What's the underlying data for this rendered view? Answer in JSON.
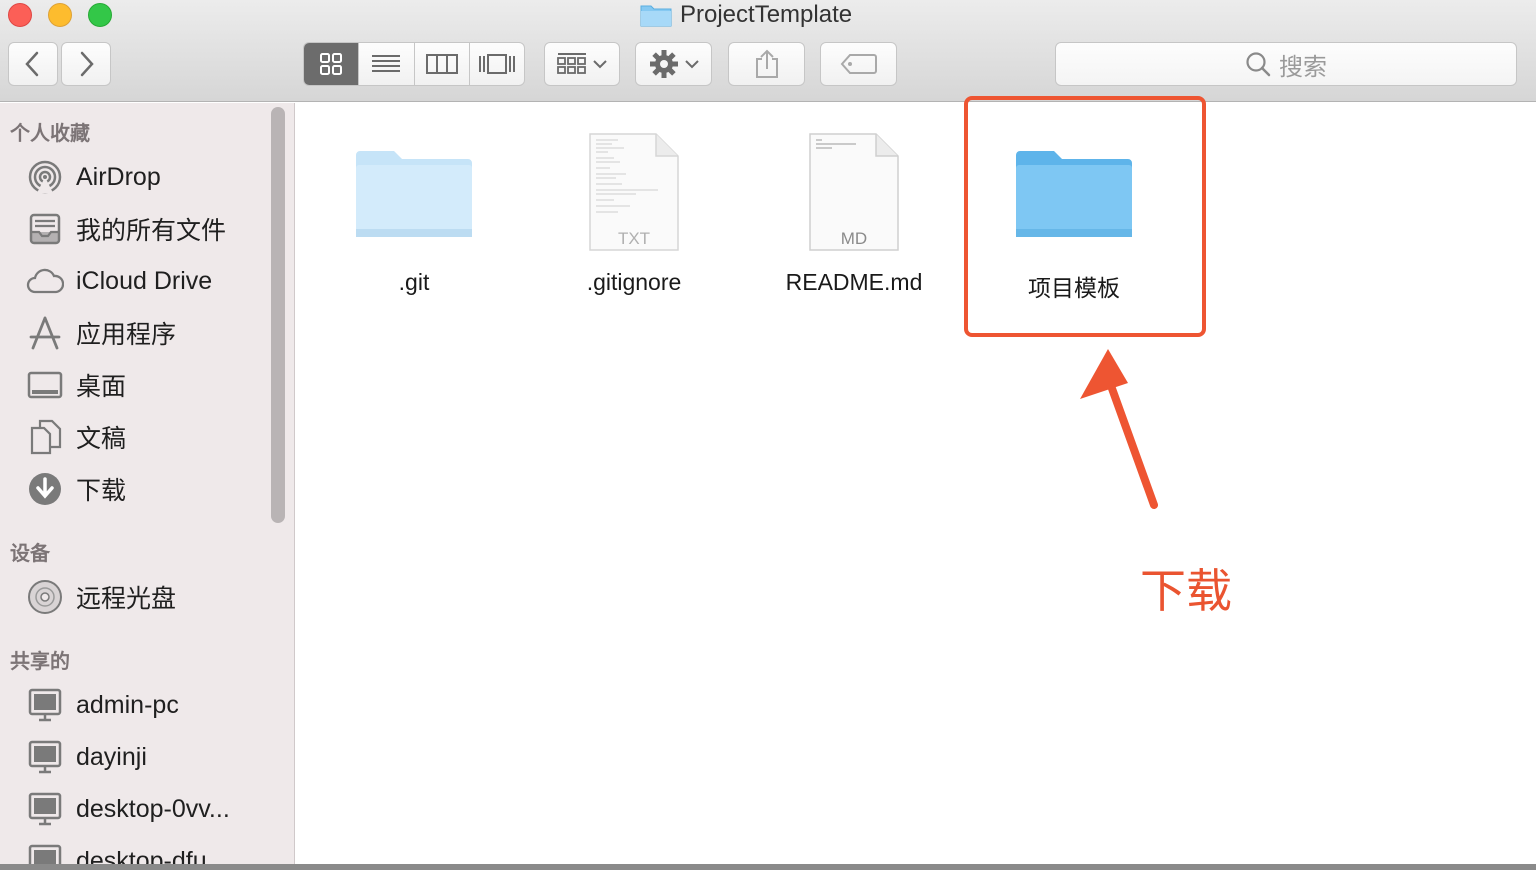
{
  "window": {
    "title": "ProjectTemplate"
  },
  "toolbar": {
    "back_icon": "chevron-left-icon",
    "forward_icon": "chevron-right-icon",
    "view_modes": [
      "icon-view-icon",
      "list-view-icon",
      "column-view-icon",
      "cover-flow-icon"
    ],
    "active_view": "icon-view-icon",
    "arrange_icon": "group-icon",
    "action_icon": "gear-icon",
    "share_icon": "share-icon",
    "tag_icon": "tag-icon",
    "search_placeholder": "搜索"
  },
  "sidebar": {
    "favorites_header": "个人收藏",
    "favorites": [
      {
        "label": "AirDrop",
        "icon": "airdrop-icon"
      },
      {
        "label": "我的所有文件",
        "icon": "all-files-icon"
      },
      {
        "label": "iCloud Drive",
        "icon": "cloud-icon"
      },
      {
        "label": "应用程序",
        "icon": "applications-icon"
      },
      {
        "label": "桌面",
        "icon": "desktop-icon"
      },
      {
        "label": "文稿",
        "icon": "documents-icon"
      },
      {
        "label": "下载",
        "icon": "download-icon"
      }
    ],
    "devices_header": "设备",
    "devices": [
      {
        "label": "远程光盘",
        "icon": "disc-icon"
      }
    ],
    "shared_header": "共享的",
    "shared": [
      {
        "label": "admin-pc",
        "icon": "computer-icon"
      },
      {
        "label": "dayinji",
        "icon": "computer-icon"
      },
      {
        "label": "desktop-0vv...",
        "icon": "computer-icon"
      },
      {
        "label": "desktop-dfu",
        "icon": "computer-icon"
      }
    ]
  },
  "files": [
    {
      "name": ".git",
      "kind": "folder"
    },
    {
      "name": ".gitignore",
      "kind": "document",
      "badge": "TXT"
    },
    {
      "name": "README.md",
      "kind": "document",
      "badge": "MD"
    },
    {
      "name": "项目模板",
      "kind": "folder"
    }
  ],
  "annotation": {
    "text": "下载",
    "color": "#ea5430"
  },
  "colors": {
    "folder_blue": "#7ec7f3",
    "accent_red": "#ee5532"
  }
}
